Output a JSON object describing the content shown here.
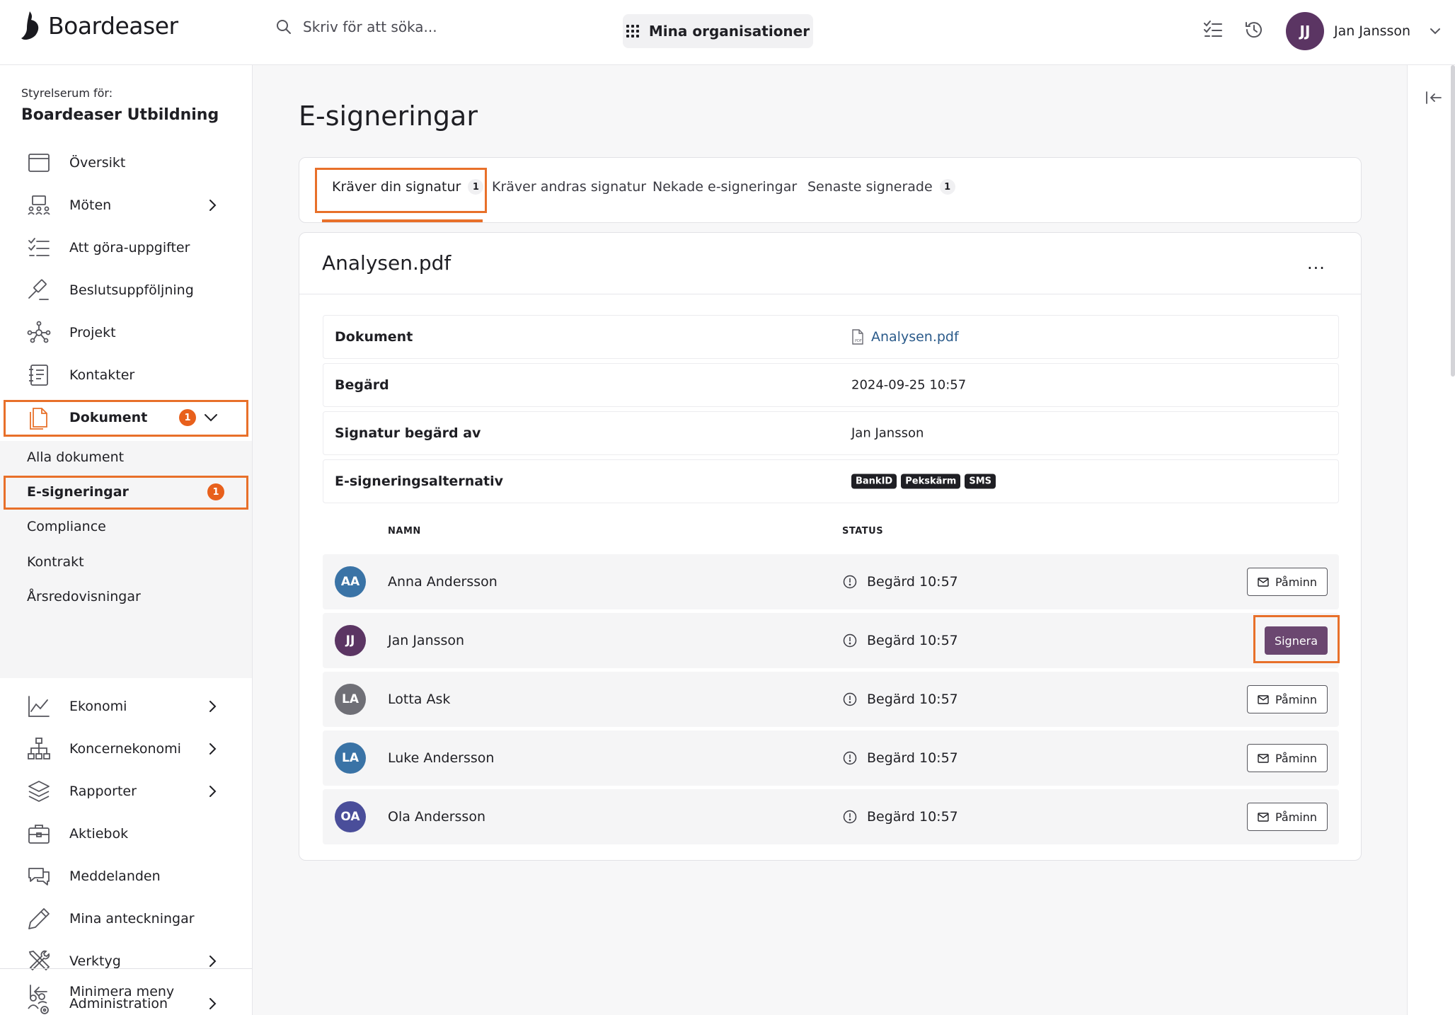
{
  "app": {
    "name": "Boardeaser"
  },
  "search": {
    "placeholder": "Skriv för att söka..."
  },
  "org_switch": {
    "label": "Mina organisationer"
  },
  "user": {
    "initials": "JJ",
    "name": "Jan Jansson"
  },
  "sidebar": {
    "org_label": "Styrelserum för:",
    "org_name": "Boardeaser Utbildning",
    "items": [
      {
        "label": "Översikt",
        "icon": "overview-icon"
      },
      {
        "label": "Möten",
        "icon": "meetings-icon",
        "chevron": true
      },
      {
        "label": "Att göra-uppgifter",
        "icon": "tasks-icon"
      },
      {
        "label": "Beslutsuppföljning",
        "icon": "gavel-icon"
      },
      {
        "label": "Projekt",
        "icon": "project-icon"
      },
      {
        "label": "Kontakter",
        "icon": "contacts-icon"
      },
      {
        "label": "Dokument",
        "icon": "document-icon",
        "badge": "1",
        "expanded": true
      },
      {
        "label": "Ekonomi",
        "icon": "chart-icon",
        "chevron": true
      },
      {
        "label": "Koncernekonomi",
        "icon": "org-chart-icon",
        "chevron": true
      },
      {
        "label": "Rapporter",
        "icon": "layers-icon",
        "chevron": true
      },
      {
        "label": "Aktiebok",
        "icon": "briefcase-icon"
      },
      {
        "label": "Meddelanden",
        "icon": "chat-icon"
      },
      {
        "label": "Mina anteckningar",
        "icon": "pencil-icon"
      },
      {
        "label": "Verktyg",
        "icon": "tools-icon",
        "chevron": true
      },
      {
        "label": "Administration",
        "icon": "admin-icon",
        "chevron": true
      }
    ],
    "sub_items": [
      {
        "label": "Alla dokument"
      },
      {
        "label": "E-signeringar",
        "badge": "1",
        "active": true
      },
      {
        "label": "Compliance"
      },
      {
        "label": "Kontrakt"
      },
      {
        "label": "Årsredovisningar"
      }
    ],
    "collapse_label": "Minimera meny"
  },
  "page": {
    "title": "E-signeringar"
  },
  "tabs": [
    {
      "label": "Kräver din signatur",
      "count": "1",
      "active": true
    },
    {
      "label": "Kräver andras signatur"
    },
    {
      "label": "Nekade e-signeringar"
    },
    {
      "label": "Senaste signerade",
      "count": "1"
    }
  ],
  "document": {
    "title": "Analysen.pdf",
    "more": "···",
    "fields": {
      "dokument_label": "Dokument",
      "dokument_value": "Analysen.pdf",
      "begard_label": "Begärd",
      "begard_value": "2024-09-25 10:57",
      "requested_by_label": "Signatur begärd av",
      "requested_by_value": "Jan Jansson",
      "methods_label": "E-signeringsalternativ",
      "methods": [
        "BankID",
        "Pekskärm",
        "SMS"
      ]
    },
    "columns": {
      "name": "NAMN",
      "status": "STATUS"
    },
    "signers": [
      {
        "initials": "AA",
        "name": "Anna Andersson",
        "status": "Begärd 10:57",
        "action": "Påminn",
        "color": "#3a73a6"
      },
      {
        "initials": "JJ",
        "name": "Jan Jansson",
        "status": "Begärd 10:57",
        "action": "Signera",
        "color": "#5b3563"
      },
      {
        "initials": "LA",
        "name": "Lotta Ask",
        "status": "Begärd 10:57",
        "action": "Påminn",
        "color": "#6f6f76"
      },
      {
        "initials": "LA",
        "name": "Luke Andersson",
        "status": "Begärd 10:57",
        "action": "Påminn",
        "color": "#3a73a6"
      },
      {
        "initials": "OA",
        "name": "Ola Andersson",
        "status": "Begärd 10:57",
        "action": "Påminn",
        "color": "#4a4e9a"
      }
    ]
  },
  "colors": {
    "accent": "#e8702a",
    "badge": "#e8601c",
    "sign_button": "#6b4770",
    "user_avatar": "#5b3563"
  }
}
